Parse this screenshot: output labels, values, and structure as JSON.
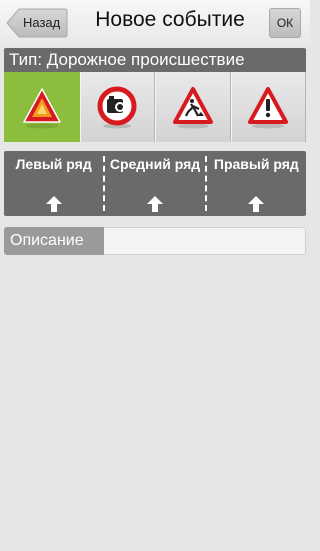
{
  "header": {
    "back_label": "Назад",
    "title": "Новое событие",
    "ok_label": "ОК"
  },
  "type_panel": {
    "label": "Тип: Дорожное происшествие",
    "options": [
      {
        "icon": "accident-warning-icon",
        "selected": true
      },
      {
        "icon": "speed-camera-icon",
        "selected": false
      },
      {
        "icon": "road-works-icon",
        "selected": false
      },
      {
        "icon": "danger-warning-icon",
        "selected": false
      }
    ]
  },
  "lanes": [
    {
      "label": "Левый ряд"
    },
    {
      "label": "Средний ряд"
    },
    {
      "label": "Правый ряд"
    }
  ],
  "description": {
    "label": "Описание",
    "value": ""
  },
  "colors": {
    "selected": "#8dbd3c",
    "panel": "#6a6a6a",
    "warning_red": "#d71920",
    "warning_orange": "#f39a1e"
  }
}
